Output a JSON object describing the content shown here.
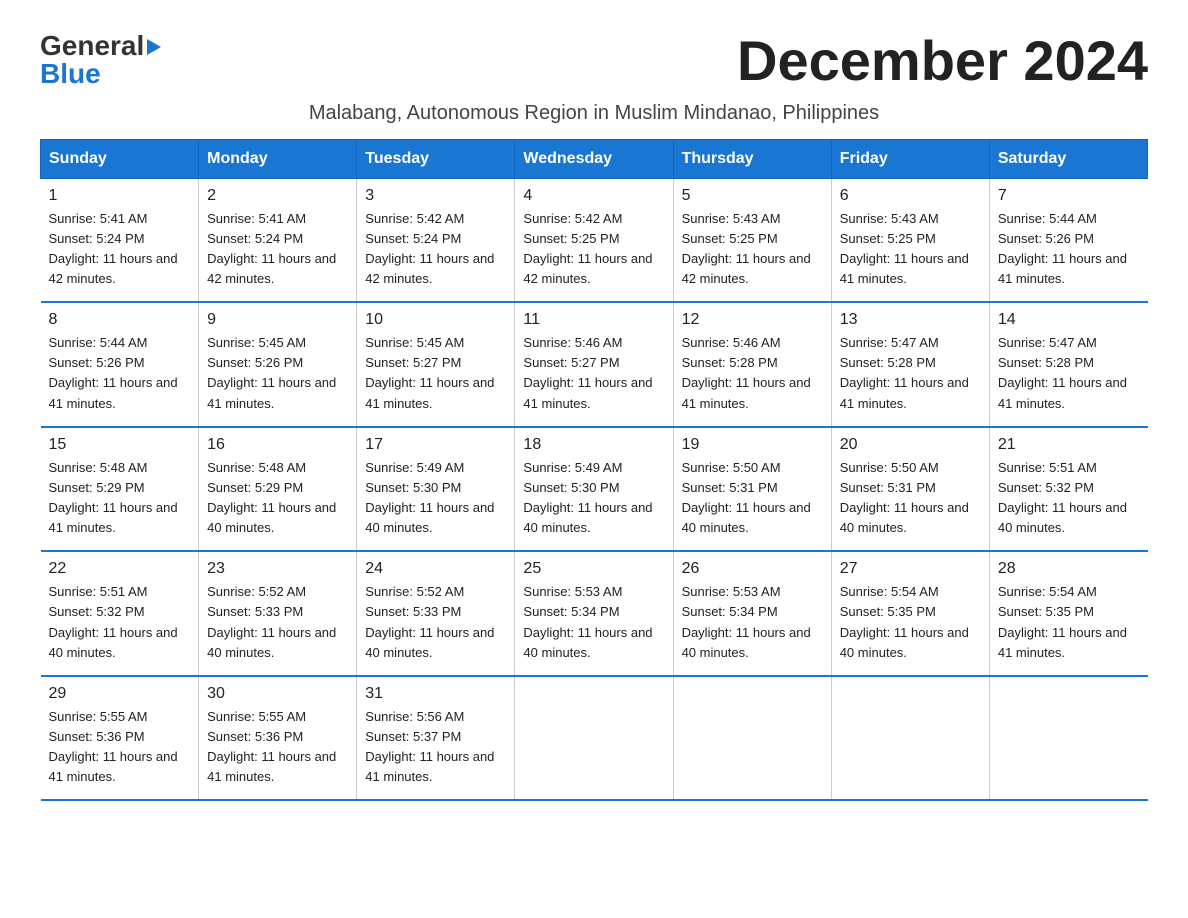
{
  "logo": {
    "part1": "General",
    "part2": "Blue"
  },
  "title": "December 2024",
  "subtitle": "Malabang, Autonomous Region in Muslim Mindanao, Philippines",
  "days_of_week": [
    "Sunday",
    "Monday",
    "Tuesday",
    "Wednesday",
    "Thursday",
    "Friday",
    "Saturday"
  ],
  "weeks": [
    [
      {
        "day": "1",
        "sunrise": "5:41 AM",
        "sunset": "5:24 PM",
        "daylight": "11 hours and 42 minutes."
      },
      {
        "day": "2",
        "sunrise": "5:41 AM",
        "sunset": "5:24 PM",
        "daylight": "11 hours and 42 minutes."
      },
      {
        "day": "3",
        "sunrise": "5:42 AM",
        "sunset": "5:24 PM",
        "daylight": "11 hours and 42 minutes."
      },
      {
        "day": "4",
        "sunrise": "5:42 AM",
        "sunset": "5:25 PM",
        "daylight": "11 hours and 42 minutes."
      },
      {
        "day": "5",
        "sunrise": "5:43 AM",
        "sunset": "5:25 PM",
        "daylight": "11 hours and 42 minutes."
      },
      {
        "day": "6",
        "sunrise": "5:43 AM",
        "sunset": "5:25 PM",
        "daylight": "11 hours and 41 minutes."
      },
      {
        "day": "7",
        "sunrise": "5:44 AM",
        "sunset": "5:26 PM",
        "daylight": "11 hours and 41 minutes."
      }
    ],
    [
      {
        "day": "8",
        "sunrise": "5:44 AM",
        "sunset": "5:26 PM",
        "daylight": "11 hours and 41 minutes."
      },
      {
        "day": "9",
        "sunrise": "5:45 AM",
        "sunset": "5:26 PM",
        "daylight": "11 hours and 41 minutes."
      },
      {
        "day": "10",
        "sunrise": "5:45 AM",
        "sunset": "5:27 PM",
        "daylight": "11 hours and 41 minutes."
      },
      {
        "day": "11",
        "sunrise": "5:46 AM",
        "sunset": "5:27 PM",
        "daylight": "11 hours and 41 minutes."
      },
      {
        "day": "12",
        "sunrise": "5:46 AM",
        "sunset": "5:28 PM",
        "daylight": "11 hours and 41 minutes."
      },
      {
        "day": "13",
        "sunrise": "5:47 AM",
        "sunset": "5:28 PM",
        "daylight": "11 hours and 41 minutes."
      },
      {
        "day": "14",
        "sunrise": "5:47 AM",
        "sunset": "5:28 PM",
        "daylight": "11 hours and 41 minutes."
      }
    ],
    [
      {
        "day": "15",
        "sunrise": "5:48 AM",
        "sunset": "5:29 PM",
        "daylight": "11 hours and 41 minutes."
      },
      {
        "day": "16",
        "sunrise": "5:48 AM",
        "sunset": "5:29 PM",
        "daylight": "11 hours and 40 minutes."
      },
      {
        "day": "17",
        "sunrise": "5:49 AM",
        "sunset": "5:30 PM",
        "daylight": "11 hours and 40 minutes."
      },
      {
        "day": "18",
        "sunrise": "5:49 AM",
        "sunset": "5:30 PM",
        "daylight": "11 hours and 40 minutes."
      },
      {
        "day": "19",
        "sunrise": "5:50 AM",
        "sunset": "5:31 PM",
        "daylight": "11 hours and 40 minutes."
      },
      {
        "day": "20",
        "sunrise": "5:50 AM",
        "sunset": "5:31 PM",
        "daylight": "11 hours and 40 minutes."
      },
      {
        "day": "21",
        "sunrise": "5:51 AM",
        "sunset": "5:32 PM",
        "daylight": "11 hours and 40 minutes."
      }
    ],
    [
      {
        "day": "22",
        "sunrise": "5:51 AM",
        "sunset": "5:32 PM",
        "daylight": "11 hours and 40 minutes."
      },
      {
        "day": "23",
        "sunrise": "5:52 AM",
        "sunset": "5:33 PM",
        "daylight": "11 hours and 40 minutes."
      },
      {
        "day": "24",
        "sunrise": "5:52 AM",
        "sunset": "5:33 PM",
        "daylight": "11 hours and 40 minutes."
      },
      {
        "day": "25",
        "sunrise": "5:53 AM",
        "sunset": "5:34 PM",
        "daylight": "11 hours and 40 minutes."
      },
      {
        "day": "26",
        "sunrise": "5:53 AM",
        "sunset": "5:34 PM",
        "daylight": "11 hours and 40 minutes."
      },
      {
        "day": "27",
        "sunrise": "5:54 AM",
        "sunset": "5:35 PM",
        "daylight": "11 hours and 40 minutes."
      },
      {
        "day": "28",
        "sunrise": "5:54 AM",
        "sunset": "5:35 PM",
        "daylight": "11 hours and 41 minutes."
      }
    ],
    [
      {
        "day": "29",
        "sunrise": "5:55 AM",
        "sunset": "5:36 PM",
        "daylight": "11 hours and 41 minutes."
      },
      {
        "day": "30",
        "sunrise": "5:55 AM",
        "sunset": "5:36 PM",
        "daylight": "11 hours and 41 minutes."
      },
      {
        "day": "31",
        "sunrise": "5:56 AM",
        "sunset": "5:37 PM",
        "daylight": "11 hours and 41 minutes."
      },
      {
        "day": "",
        "sunrise": "",
        "sunset": "",
        "daylight": ""
      },
      {
        "day": "",
        "sunrise": "",
        "sunset": "",
        "daylight": ""
      },
      {
        "day": "",
        "sunrise": "",
        "sunset": "",
        "daylight": ""
      },
      {
        "day": "",
        "sunrise": "",
        "sunset": "",
        "daylight": ""
      }
    ]
  ],
  "labels": {
    "sunrise": "Sunrise:",
    "sunset": "Sunset:",
    "daylight": "Daylight:"
  }
}
